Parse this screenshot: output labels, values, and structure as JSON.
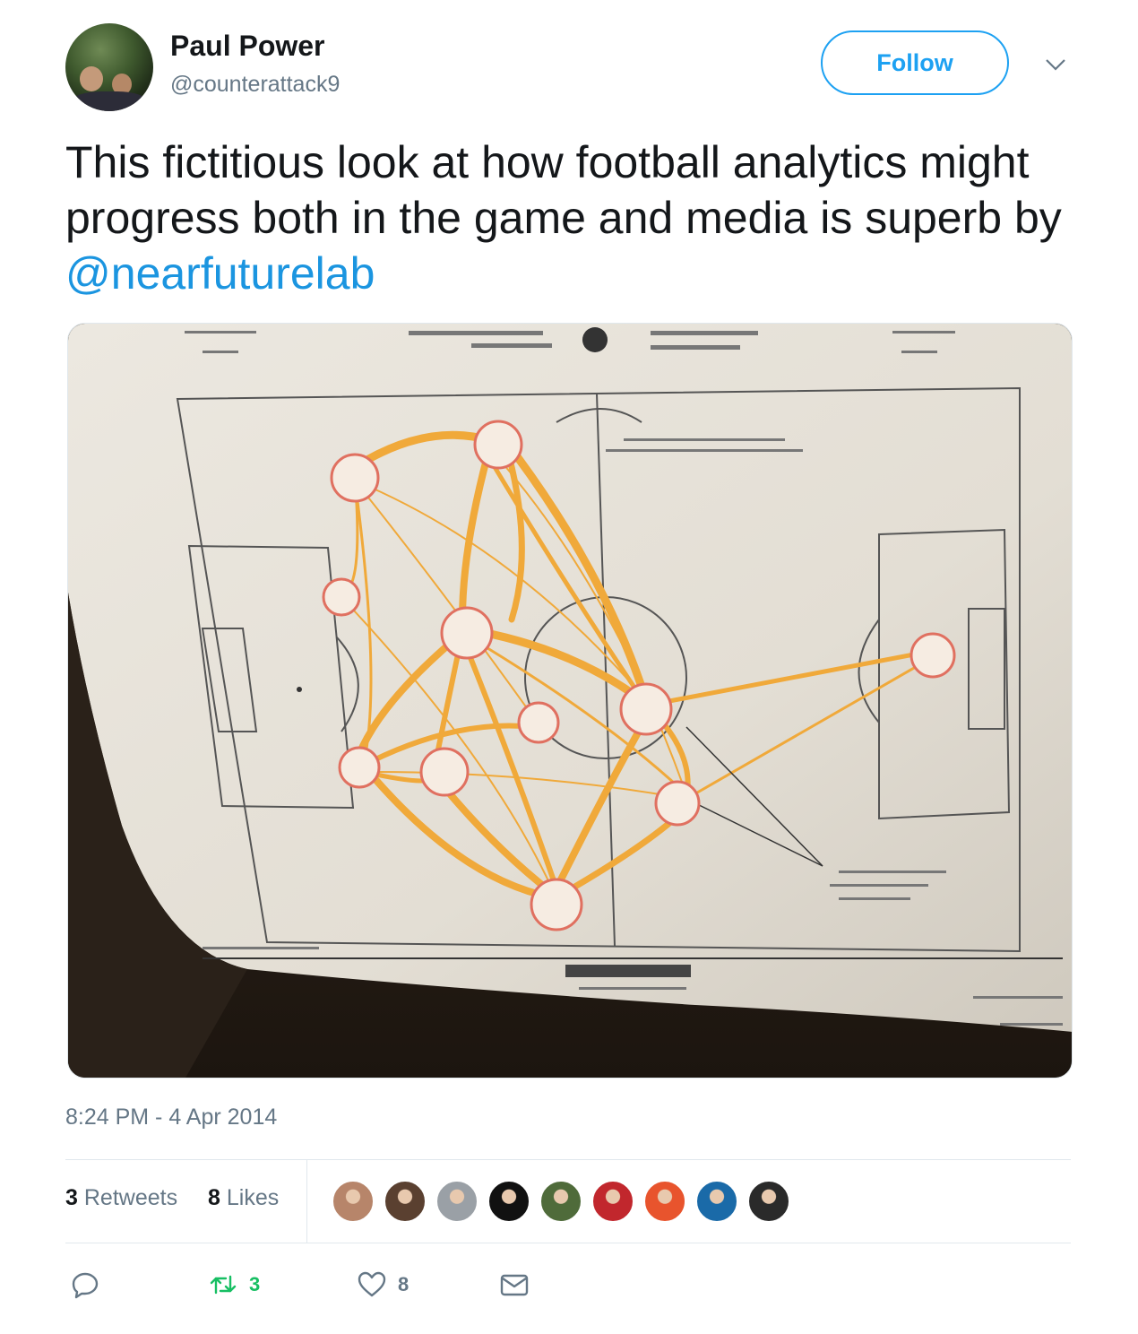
{
  "author": {
    "display_name": "Paul Power",
    "handle": "@counterattack9"
  },
  "follow_button": {
    "label": "Follow"
  },
  "tweet": {
    "text_before": "This fictitious look at how football analytics might progress both in the game and media is superb by ",
    "mention": "@nearfuturelab"
  },
  "timestamp": "8:24 PM - 4 Apr 2014",
  "stats": {
    "retweets_count": "3",
    "retweets_label": "Retweets",
    "likes_count": "8",
    "likes_label": "Likes"
  },
  "actions": {
    "reply_icon": "reply-icon",
    "retweet_icon": "retweet-icon",
    "retweet_count": "3",
    "like_icon": "heart-icon",
    "like_count": "8",
    "dm_icon": "envelope-icon"
  },
  "colors": {
    "accent": "#1da1f2",
    "link": "#1b95e0",
    "muted": "#657786",
    "retweet_green": "#17bf63",
    "passing_network": "#f0a93a",
    "player_nodes": "#e07060"
  },
  "likers": [
    {
      "name": "liker-1",
      "color": "#b7856a"
    },
    {
      "name": "liker-2",
      "color": "#5a4030"
    },
    {
      "name": "liker-3",
      "color": "#9aa0a6"
    },
    {
      "name": "liker-4",
      "color": "#111111"
    },
    {
      "name": "liker-5",
      "color": "#4f6b3a"
    },
    {
      "name": "liker-6",
      "color": "#c1272d"
    },
    {
      "name": "liker-7",
      "color": "#e8542d"
    },
    {
      "name": "liker-8",
      "color": "#1a6aa8"
    },
    {
      "name": "liker-9",
      "color": "#2a2a2a"
    }
  ],
  "media": {
    "image_description_icon": "football-passing-network-photo"
  }
}
